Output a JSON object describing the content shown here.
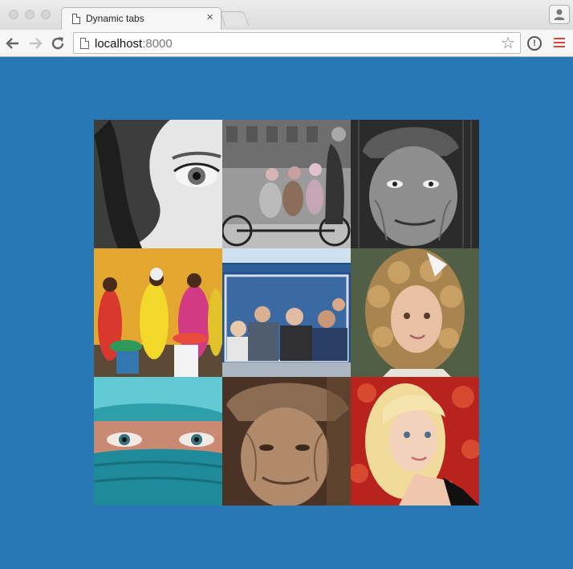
{
  "browser": {
    "tab_title": "Dynamic tabs",
    "tab_close": "×",
    "url_host": "localhost",
    "url_port": ":8000",
    "bookmark_icon": "star-icon",
    "extension_icon_glyph": "!",
    "page_background": "#2878b5"
  },
  "gallery": {
    "photos": [
      {
        "name": "photo-woman-eye",
        "subject": "woman-eye-bw"
      },
      {
        "name": "photo-children-bicycle",
        "subject": "children-bicycle-bw"
      },
      {
        "name": "photo-old-man-cap",
        "subject": "old-man-cap-bw"
      },
      {
        "name": "photo-women-colorful-dresses",
        "subject": "women-colorful-dresses"
      },
      {
        "name": "photo-people-on-tram",
        "subject": "people-on-tram"
      },
      {
        "name": "photo-curly-haired-girl",
        "subject": "curly-haired-girl"
      },
      {
        "name": "photo-veiled-woman-eyes",
        "subject": "veiled-woman-eyes"
      },
      {
        "name": "photo-old-woman-hat",
        "subject": "old-woman-hat-sepia"
      },
      {
        "name": "photo-blonde-woman",
        "subject": "blonde-woman"
      }
    ]
  }
}
